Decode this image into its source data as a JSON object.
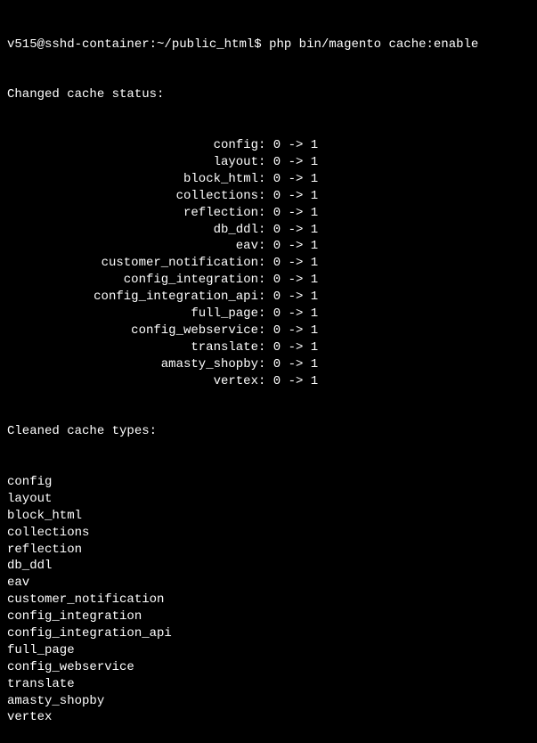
{
  "prompt": "v515@sshd-container:~/public_html$ ",
  "command": "php bin/magento cache:enable",
  "changed_header": "Changed cache status:",
  "status_rows": [
    {
      "label": "config",
      "from": "0",
      "to": "1"
    },
    {
      "label": "layout",
      "from": "0",
      "to": "1"
    },
    {
      "label": "block_html",
      "from": "0",
      "to": "1"
    },
    {
      "label": "collections",
      "from": "0",
      "to": "1"
    },
    {
      "label": "reflection",
      "from": "0",
      "to": "1"
    },
    {
      "label": "db_ddl",
      "from": "0",
      "to": "1"
    },
    {
      "label": "eav",
      "from": "0",
      "to": "1"
    },
    {
      "label": "customer_notification",
      "from": "0",
      "to": "1"
    },
    {
      "label": "config_integration",
      "from": "0",
      "to": "1"
    },
    {
      "label": "config_integration_api",
      "from": "0",
      "to": "1"
    },
    {
      "label": "full_page",
      "from": "0",
      "to": "1"
    },
    {
      "label": "config_webservice",
      "from": "0",
      "to": "1"
    },
    {
      "label": "translate",
      "from": "0",
      "to": "1"
    },
    {
      "label": "amasty_shopby",
      "from": "0",
      "to": "1"
    },
    {
      "label": "vertex",
      "from": "0",
      "to": "1"
    }
  ],
  "cleaned_header": "Cleaned cache types:",
  "cleaned_types": [
    "config",
    "layout",
    "block_html",
    "collections",
    "reflection",
    "db_ddl",
    "eav",
    "customer_notification",
    "config_integration",
    "config_integration_api",
    "full_page",
    "config_webservice",
    "translate",
    "amasty_shopby",
    "vertex"
  ]
}
